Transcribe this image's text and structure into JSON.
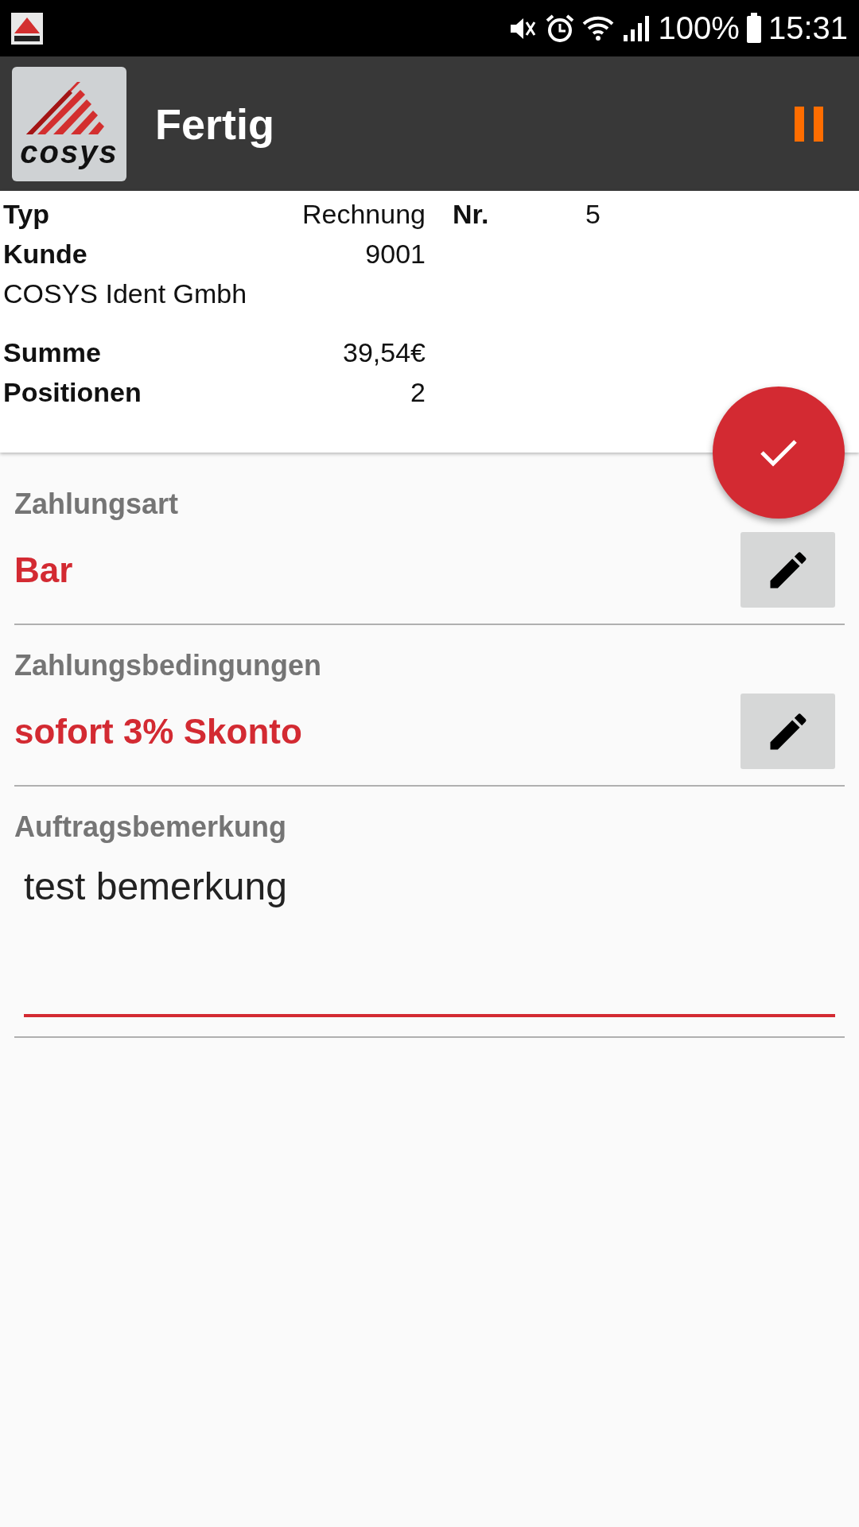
{
  "status_bar": {
    "battery": "100%",
    "time": "15:31"
  },
  "toolbar": {
    "logo_text": "cosys",
    "title": "Fertig"
  },
  "summary": {
    "type_label": "Typ",
    "type_value": "Rechnung",
    "nr_label": "Nr.",
    "nr_value": "5",
    "customer_label": "Kunde",
    "customer_value": "9001",
    "customer_name": "COSYS Ident Gmbh",
    "sum_label": "Summe",
    "sum_value": "39,54€",
    "positions_label": "Positionen",
    "positions_value": "2"
  },
  "sections": [
    {
      "kind": "choice",
      "label": "Zahlungsart",
      "value": "Bar"
    },
    {
      "kind": "choice",
      "label": "Zahlungsbedingungen",
      "value": "sofort 3% Skonto"
    },
    {
      "kind": "textarea",
      "label": "Auftragsbemerkung",
      "value": "test bemerkung",
      "focused": true
    }
  ]
}
